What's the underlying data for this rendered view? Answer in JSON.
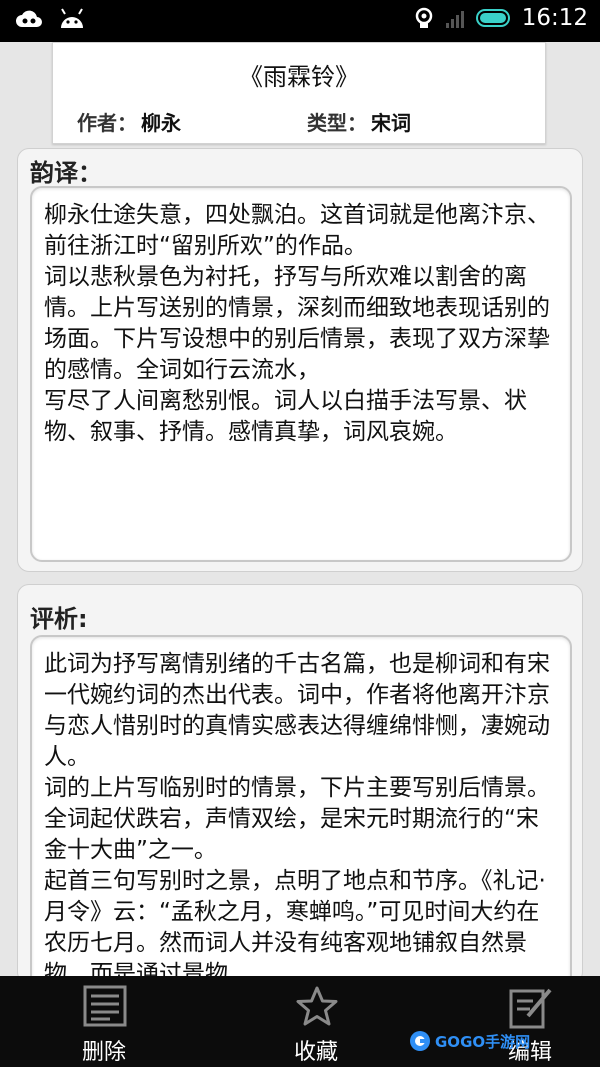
{
  "status_bar": {
    "time": "16:12",
    "icons": [
      "cloud-icon",
      "android-icon",
      "sync-icon",
      "signal-icon",
      "battery-icon"
    ]
  },
  "header": {
    "title": "《雨霖铃》",
    "author_label": "作者：",
    "author": "柳永",
    "type_label": "类型：",
    "type": "宋词"
  },
  "translation": {
    "heading": "韵译：",
    "text": "柳永仕途失意，四处飘泊。这首词就是他离汴京、前往浙江时“留别所欢”的作品。\n词以悲秋景色为衬托，抒写与所欢难以割舍的离情。上片写送别的情景，深刻而细致地表现话别的场面。下片写设想中的别后情景，表现了双方深挚的感情。全词如行云流水，\n写尽了人间离愁别恨。词人以白描手法写景、状物、叙事、抒情。感情真挚，词风哀婉。"
  },
  "analysis": {
    "heading": "评析:",
    "text": "此词为抒写离情别绪的千古名篇，也是柳词和有宋一代婉约词的杰出代表。词中，作者将他离开汴京与恋人惜别时的真情实感表达得缠绵悱恻，凄婉动人。\n词的上片写临别时的情景，下片主要写别后情景。全词起伏跌宕，声情双绘，是宋元时期流行的“宋金十大曲”之一。\n起首三句写别时之景，点明了地点和节序。《礼记·月令》云：“孟秋之月，寒蝉鸣。”可见时间大约在农历七月。然而词人并没有纯客观地铺叙自然景物，而是通过景物"
  },
  "bottom_bar": {
    "delete_label": "删除",
    "favorite_label": "收藏",
    "edit_label": "编辑"
  },
  "watermark": {
    "text": "GOGO手游网"
  },
  "colors": {
    "battery": "#3ad1c9",
    "watermark": "#2f8ff5",
    "bottom_bar_bg": "#0c0c0c"
  }
}
